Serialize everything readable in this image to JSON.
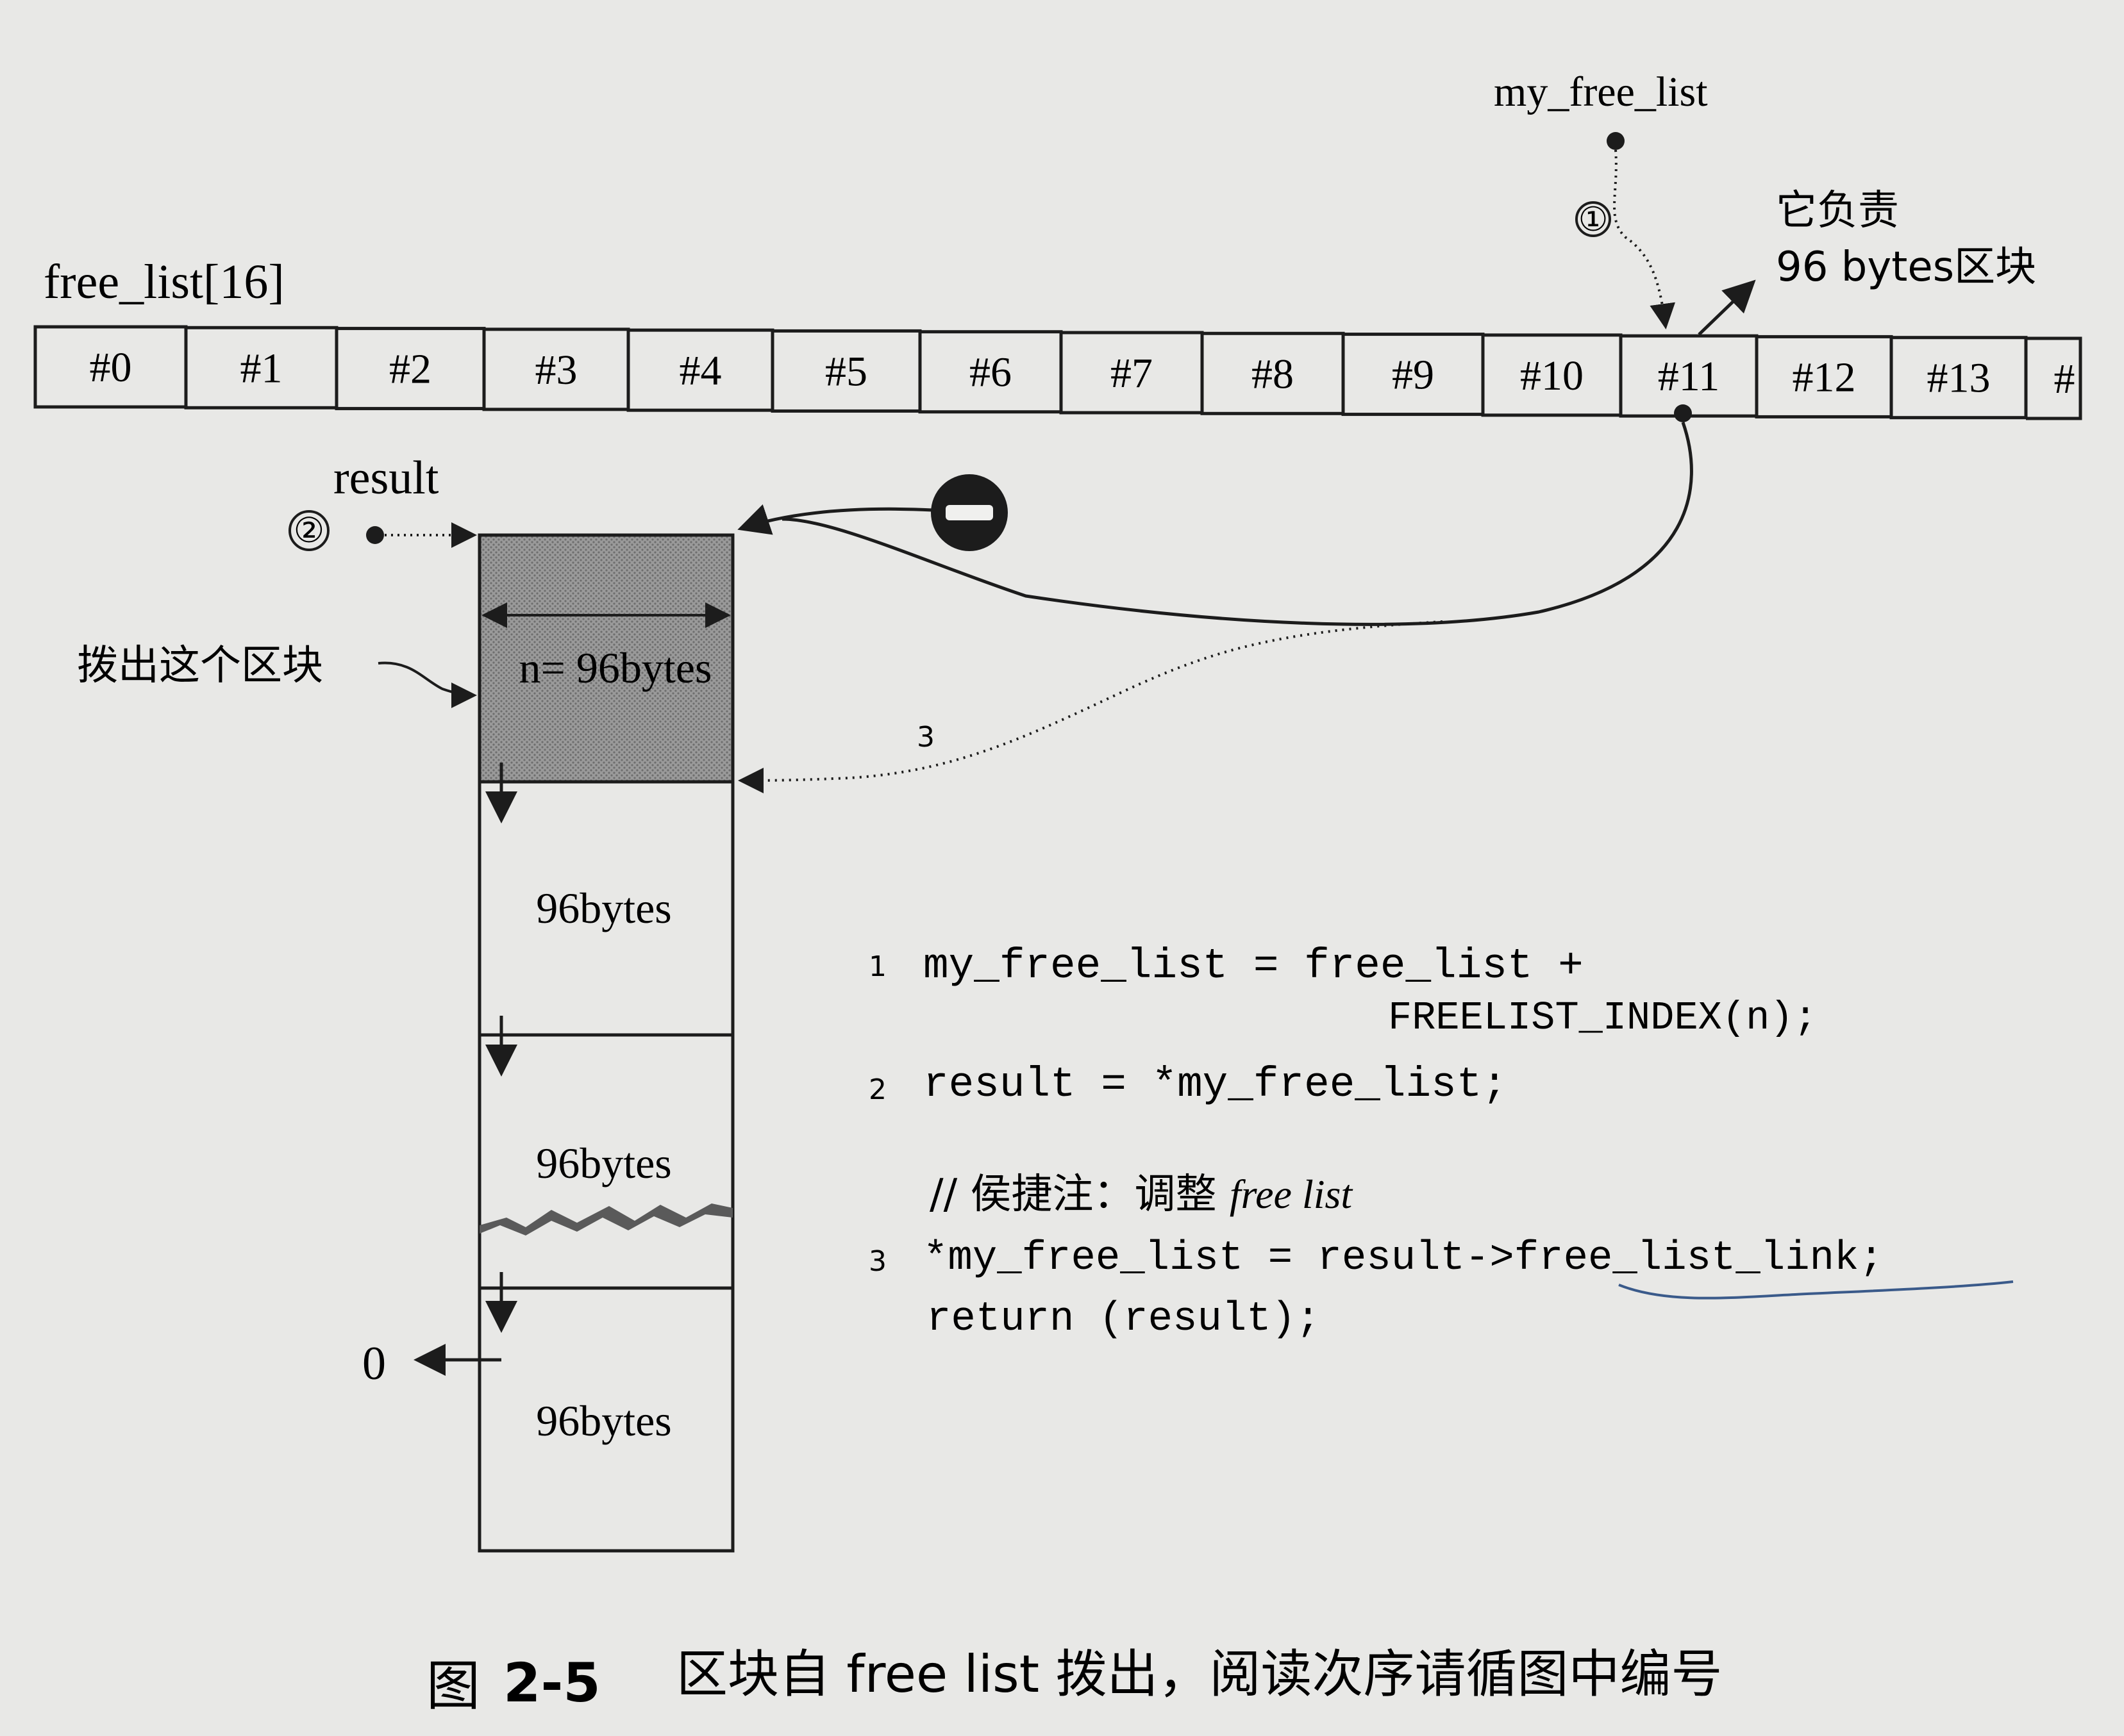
{
  "labels": {
    "my_free_list": "my_free_list",
    "free_list_array": "free_list[16]",
    "result": "result",
    "annotation_96": "它负责\n96 bytes区块",
    "pull_out": "拨出这个区块",
    "zero": "0"
  },
  "step_markers": [
    "①",
    "②"
  ],
  "arrow_step3_label": "3",
  "cells": [
    "#0",
    "#1",
    "#2",
    "#3",
    "#4",
    "#5",
    "#6",
    "#7",
    "#8",
    "#9",
    "#10",
    "#11",
    "#12",
    "#13",
    "#"
  ],
  "blocks": [
    "n= 96bytes",
    "96bytes",
    "96bytes",
    "96bytes"
  ],
  "code": [
    {
      "num": "1",
      "text": "my_free_list = free_list +"
    },
    {
      "num": "",
      "text": "FREELIST_INDEX(n);"
    },
    {
      "num": "2",
      "text": "result = *my_free_list;"
    },
    {
      "num": "",
      "text": "// 侯捷注：调整 free list"
    },
    {
      "num": "3",
      "text": "*my_free_list = result->free_list_link;"
    },
    {
      "num": "",
      "text": "return (result);"
    }
  ],
  "caption": {
    "prefix": "图",
    "number": "2-5",
    "text": "区块自 free list 拨出，阅读次序请循图中编号"
  },
  "colors": {
    "paper": "#e8e8e6",
    "ink": "#1c1c1c",
    "shaded_block": "#8c8c8c",
    "handwriting": "#3a5a8a"
  }
}
